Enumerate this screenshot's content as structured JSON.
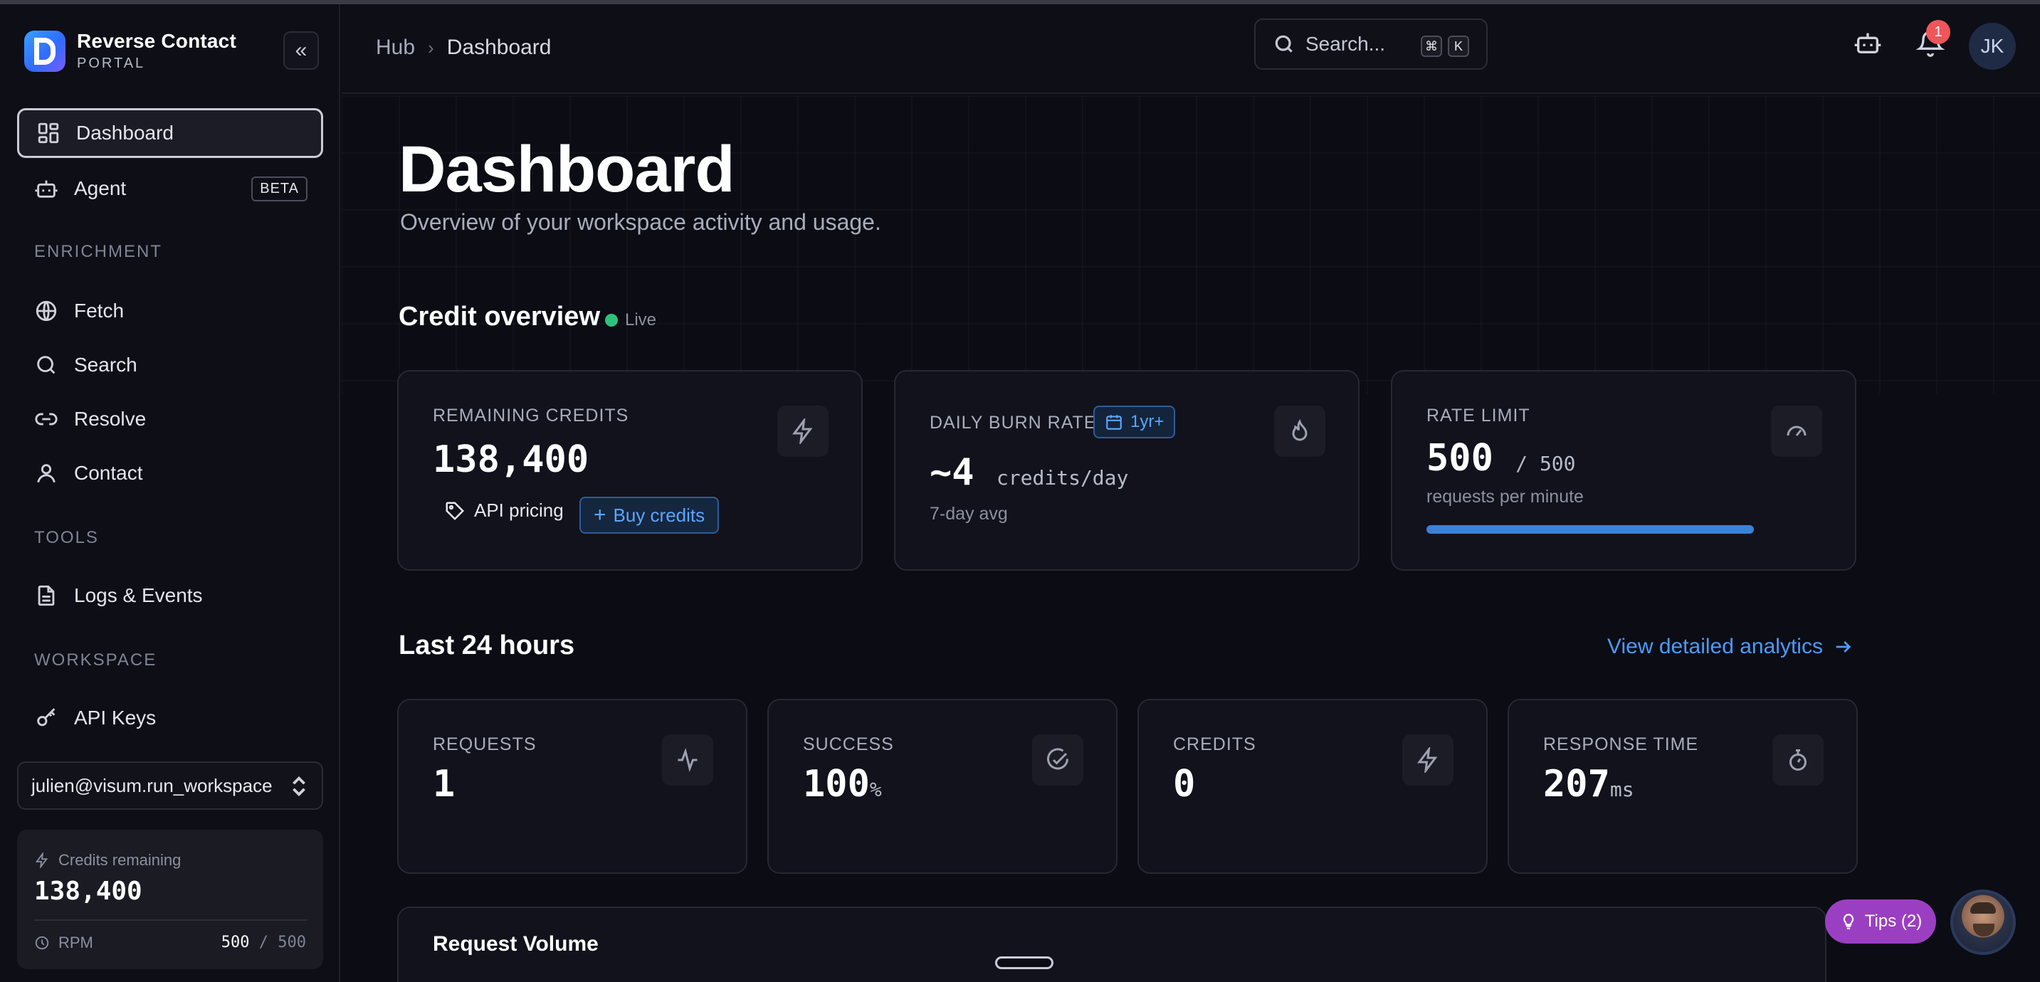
{
  "brand": {
    "name": "Reverse Contact",
    "sub": "PORTAL"
  },
  "sidebar": {
    "items": [
      {
        "label": "Dashboard",
        "icon": "dashboard-icon",
        "active": true
      },
      {
        "label": "Agent",
        "icon": "bot-icon",
        "badge": "BETA"
      },
      {
        "label": "Fetch",
        "icon": "globe-icon"
      },
      {
        "label": "Search",
        "icon": "search-icon"
      },
      {
        "label": "Resolve",
        "icon": "link-icon"
      },
      {
        "label": "Contact",
        "icon": "user-icon"
      },
      {
        "label": "Logs & Events",
        "icon": "file-icon"
      },
      {
        "label": "API Keys",
        "icon": "key-icon"
      }
    ],
    "sections": {
      "enrichment": "ENRICHMENT",
      "tools": "TOOLS",
      "workspace": "WORKSPACE"
    },
    "workspace_name": "julien@visum.run_workspace",
    "credits_label": "Credits remaining",
    "credits_value": "138,400",
    "rpm_label": "RPM",
    "rpm_used": "500",
    "rpm_sep": "/",
    "rpm_total": "500"
  },
  "topbar": {
    "breadcrumb": {
      "root": "Hub",
      "current": "Dashboard"
    },
    "search_placeholder": "Search...",
    "shortcut": [
      "⌘",
      "K"
    ],
    "notification_count": "1",
    "user_initials": "JK"
  },
  "main": {
    "title": "Dashboard",
    "subtitle": "Overview of your workspace activity and usage.",
    "credit_overview": {
      "heading": "Credit overview",
      "live_label": "Live",
      "remaining": {
        "label": "REMAINING CREDITS",
        "value": "138,400",
        "api_pricing": "API pricing",
        "buy": "Buy credits"
      },
      "burn": {
        "label": "DAILY BURN RATE",
        "range": "1yr+",
        "value": "~4",
        "unit": "credits/day",
        "note": "7-day avg"
      },
      "rate": {
        "label": "RATE LIMIT",
        "value": "500",
        "total": "/ 500",
        "note": "requests per minute",
        "fill_pct": 100
      }
    },
    "last24": {
      "heading": "Last 24 hours",
      "view_link": "View detailed analytics",
      "stats": [
        {
          "label": "REQUESTS",
          "value": "1",
          "unit": "",
          "icon": "activity-icon"
        },
        {
          "label": "SUCCESS",
          "value": "100",
          "unit": "%",
          "icon": "check-circle-icon"
        },
        {
          "label": "CREDITS",
          "value": "0",
          "unit": "",
          "icon": "lightning-icon"
        },
        {
          "label": "RESPONSE TIME",
          "value": "207",
          "unit": "ms",
          "icon": "stopwatch-icon"
        }
      ]
    },
    "request_volume_title": "Request Volume"
  },
  "tips": {
    "label": "Tips (2)"
  },
  "colors": {
    "accent": "#4a9cff",
    "live": "#2fc27a",
    "tips": "#9b3fc2",
    "badge": "#f0555a"
  }
}
